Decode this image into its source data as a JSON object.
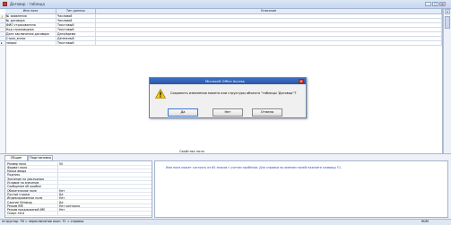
{
  "window": {
    "title": "Договор : таблица",
    "minimize": "–",
    "maximize": "□",
    "close": "×"
  },
  "grid": {
    "headers": [
      "Имя поля",
      "Тип данных",
      "Описание"
    ],
    "rows": [
      {
        "name": "№ заявления",
        "type": "Числовой",
        "desc": ""
      },
      {
        "name": "№ договора",
        "type": "Числовой",
        "desc": ""
      },
      {
        "name": "ФИО страхователя",
        "type": "Текстовый",
        "desc": ""
      },
      {
        "name": "Код страховщика",
        "type": "Текстовый",
        "desc": ""
      },
      {
        "name": "Дата заключения договора",
        "type": "Дата/время",
        "desc": ""
      },
      {
        "name": "Страх_взнос",
        "type": "Денежный",
        "desc": ""
      },
      {
        "name": "запрос",
        "type": "Текстовый",
        "desc": ""
      }
    ]
  },
  "props": {
    "section_title": "Свойства поля",
    "tabs": [
      "Общие",
      "Подстановка"
    ],
    "rows": [
      {
        "label": "Размер поля",
        "value": "50"
      },
      {
        "label": "Формат поля",
        "value": ""
      },
      {
        "label": "Маска ввода",
        "value": ""
      },
      {
        "label": "Подпись",
        "value": ""
      },
      {
        "label": "Значение по умолчанию",
        "value": ""
      },
      {
        "label": "Условие на значение",
        "value": ""
      },
      {
        "label": "Сообщение об ошибке",
        "value": ""
      },
      {
        "label": "Обязательное поле",
        "value": "Нет"
      },
      {
        "label": "Пустые строки",
        "value": "Да"
      },
      {
        "label": "Индексированное поле",
        "value": "Нет"
      },
      {
        "label": "Сжатие Юникод",
        "value": "Да"
      },
      {
        "label": "Режим IME",
        "value": "Нет контроля"
      },
      {
        "label": "Режим предложений IME",
        "value": "Нет"
      },
      {
        "label": "Смарт-теги",
        "value": ""
      }
    ],
    "help": "Имя поля может состоять из 64 знаков с учетом пробелов.  Для справки по именам полей нажмите клавишу F1."
  },
  "dialog": {
    "title": "Microsoft Office Access",
    "close": "×",
    "message": "Сохранить изменения макета или структуры объекта \"таблицы 'Договор'\"?",
    "buttons": [
      "Да",
      "Нет",
      "Отмена"
    ]
  },
  "status": {
    "text": "нструктор.  F6 = переключение окон.  F1 = справка.",
    "num": "NUM"
  }
}
